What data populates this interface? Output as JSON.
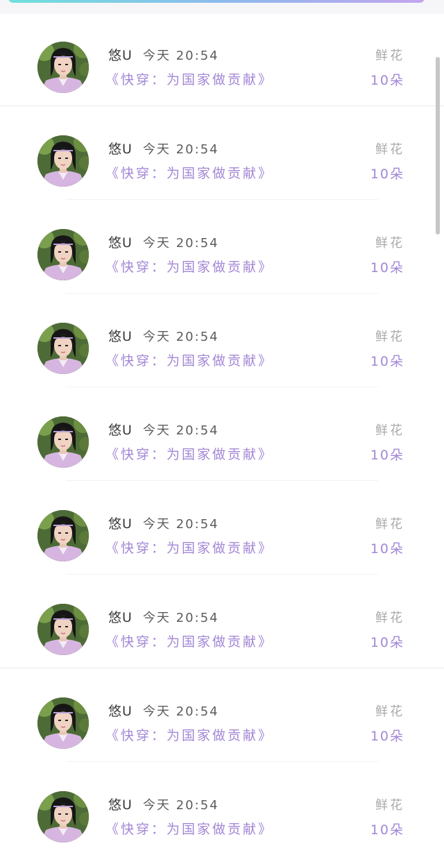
{
  "colors": {
    "accent": "#a387d6",
    "name_text": "#3a3a3a",
    "muted_text": "#a9a9a9",
    "top_bar_gradient": [
      "#6fe0dc",
      "#c4a4ee"
    ]
  },
  "records": [
    {
      "user": "悠U",
      "time": "今天 20:54",
      "book": "《快穿：为国家做贡献》",
      "gift_label": "鲜花",
      "amount": "10朵",
      "avatar_icon": "user-avatar"
    },
    {
      "user": "悠U",
      "time": "今天 20:54",
      "book": "《快穿：为国家做贡献》",
      "gift_label": "鲜花",
      "amount": "10朵",
      "avatar_icon": "user-avatar"
    },
    {
      "user": "悠U",
      "time": "今天 20:54",
      "book": "《快穿：为国家做贡献》",
      "gift_label": "鲜花",
      "amount": "10朵",
      "avatar_icon": "user-avatar"
    },
    {
      "user": "悠U",
      "time": "今天 20:54",
      "book": "《快穿：为国家做贡献》",
      "gift_label": "鲜花",
      "amount": "10朵",
      "avatar_icon": "user-avatar"
    },
    {
      "user": "悠U",
      "time": "今天 20:54",
      "book": "《快穿：为国家做贡献》",
      "gift_label": "鲜花",
      "amount": "10朵",
      "avatar_icon": "user-avatar"
    },
    {
      "user": "悠U",
      "time": "今天 20:54",
      "book": "《快穿：为国家做贡献》",
      "gift_label": "鲜花",
      "amount": "10朵",
      "avatar_icon": "user-avatar"
    },
    {
      "user": "悠U",
      "time": "今天 20:54",
      "book": "《快穿：为国家做贡献》",
      "gift_label": "鲜花",
      "amount": "10朵",
      "avatar_icon": "user-avatar"
    },
    {
      "user": "悠U",
      "time": "今天 20:54",
      "book": "《快穿：为国家做贡献》",
      "gift_label": "鲜花",
      "amount": "10朵",
      "avatar_icon": "user-avatar"
    },
    {
      "user": "悠U",
      "time": "今天 20:54",
      "book": "《快穿：为国家做贡献》",
      "gift_label": "鲜花",
      "amount": "10朵",
      "avatar_icon": "user-avatar"
    }
  ]
}
